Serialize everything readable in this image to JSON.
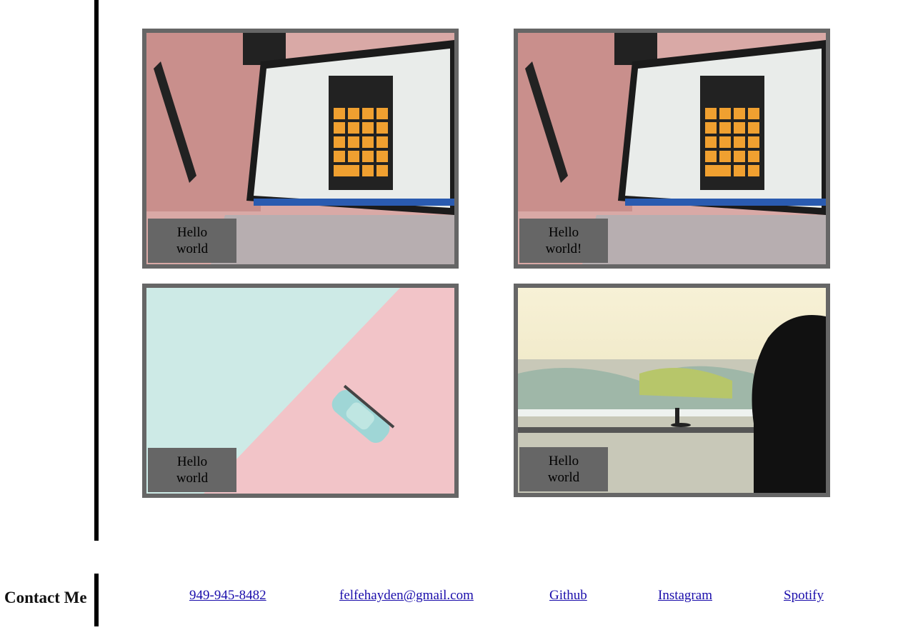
{
  "cards": [
    {
      "caption": "Hello world",
      "image": "laptop-calculator-photo"
    },
    {
      "caption": "Hello world!",
      "image": "laptop-calculator-photo"
    },
    {
      "caption": "Hello world",
      "image": "toy-car-pastel-photo"
    },
    {
      "caption": "Hello world",
      "image": "surfer-sunset-photo"
    }
  ],
  "contact": {
    "title": "Contact Me",
    "links": [
      {
        "label": "949-945-8482"
      },
      {
        "label": "felfehayden@gmail.com"
      },
      {
        "label": "Github"
      },
      {
        "label": "Instagram"
      },
      {
        "label": "Spotify"
      }
    ]
  },
  "colors": {
    "frame": "#666666",
    "caption_bg": "#666666",
    "link": "#1a0dab"
  }
}
